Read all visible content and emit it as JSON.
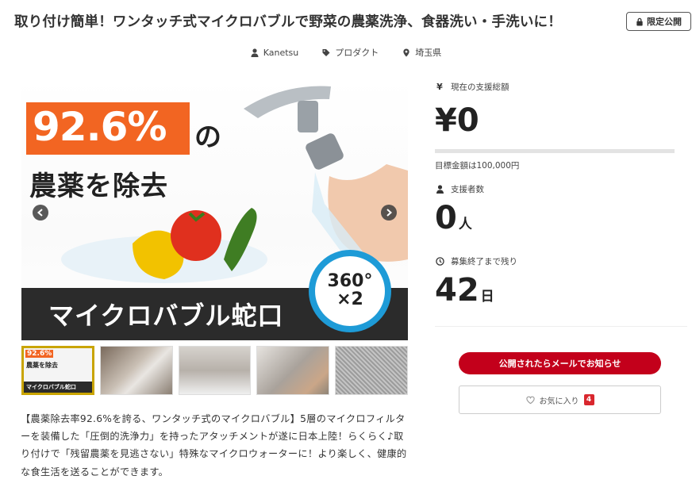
{
  "header": {
    "title": "取り付け簡単！ワンタッチ式マイクロバブルで野菜の農薬洗浄、食器洗い・手洗いに！",
    "badge_label": "限定公開",
    "badge_icon": "lock-icon"
  },
  "meta": {
    "author": "Kanetsu",
    "category": "プロダクト",
    "location": "埼玉県"
  },
  "hero": {
    "headline_pct": "92.6%",
    "headline_no": "の",
    "headline_sub": "農薬を除去",
    "bar_text": "マイクロバブル蛇口",
    "ring_line1": "360°",
    "ring_line2": "×2",
    "accent_color": "#f26522",
    "ring_color": "#1e9bd7"
  },
  "thumbnails": [
    {
      "label": "マイクロバブル蛇口",
      "mini_pct": "92.6%",
      "mini_sub": "農薬を除去",
      "active": true
    },
    {
      "label": "",
      "active": false
    },
    {
      "label": "",
      "active": false
    },
    {
      "label": "",
      "active": false
    },
    {
      "label": "",
      "active": false
    }
  ],
  "description": "【農薬除去率92.6%を誇る、ワンタッチ式のマイクロバブル】5層のマイクロフィルターを装備した「圧倒的洗浄力」を持ったアタッチメントが遂に日本上陸！らくらく♪取り付けで「残留農薬を見逃さない」特殊なマイクロウォーターに！より楽しく、健康的な食生活を送ることができます。",
  "stats": {
    "amount_label": "現在の支援総額",
    "amount_icon": "yen-icon",
    "amount_symbol": "¥",
    "amount_value": "¥0",
    "progress_fraction": 0,
    "goal_text": "目標金額は100,000円",
    "supporters_label": "支援者数",
    "supporters_value": "0",
    "supporters_unit": "人",
    "remaining_label": "募集終了まで残り",
    "remaining_value": "42",
    "remaining_unit": "日"
  },
  "actions": {
    "notify_label": "公開されたらメールでお知らせ",
    "favorite_label": "お気に入り",
    "favorite_count": "4"
  },
  "colors": {
    "primary_red": "#c3001b",
    "count_red": "#d9272e",
    "thumb_active_border": "#c9a400"
  }
}
